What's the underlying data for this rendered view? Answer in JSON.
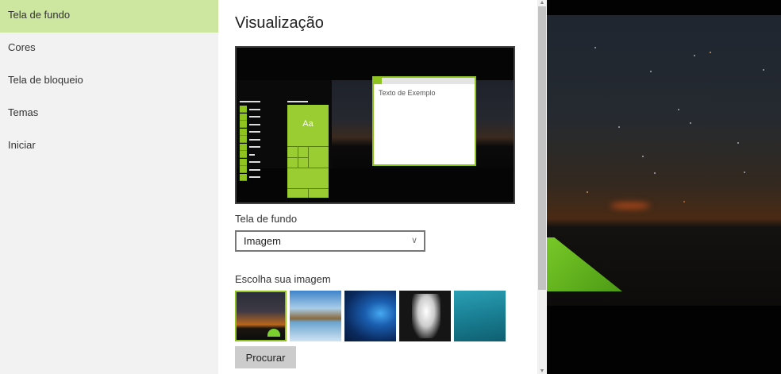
{
  "sidebar": {
    "items": [
      {
        "label": "Tela de fundo",
        "active": true
      },
      {
        "label": "Cores"
      },
      {
        "label": "Tela de bloqueio"
      },
      {
        "label": "Temas"
      },
      {
        "label": "Iniciar"
      }
    ]
  },
  "main": {
    "title": "Visualização",
    "preview": {
      "tile_label": "Aa",
      "sample_text": "Texto de Exemplo"
    },
    "background_label": "Tela de fundo",
    "background_value": "Imagem",
    "choose_label": "Escolha sua imagem",
    "thumbnails": [
      "night-sky-tent",
      "beach-rocks",
      "windows-logo",
      "stormtrooper",
      "underwater"
    ],
    "browse_label": "Procurar"
  },
  "colors": {
    "accent": "#8fc31f",
    "active_nav": "#cde6a0"
  }
}
